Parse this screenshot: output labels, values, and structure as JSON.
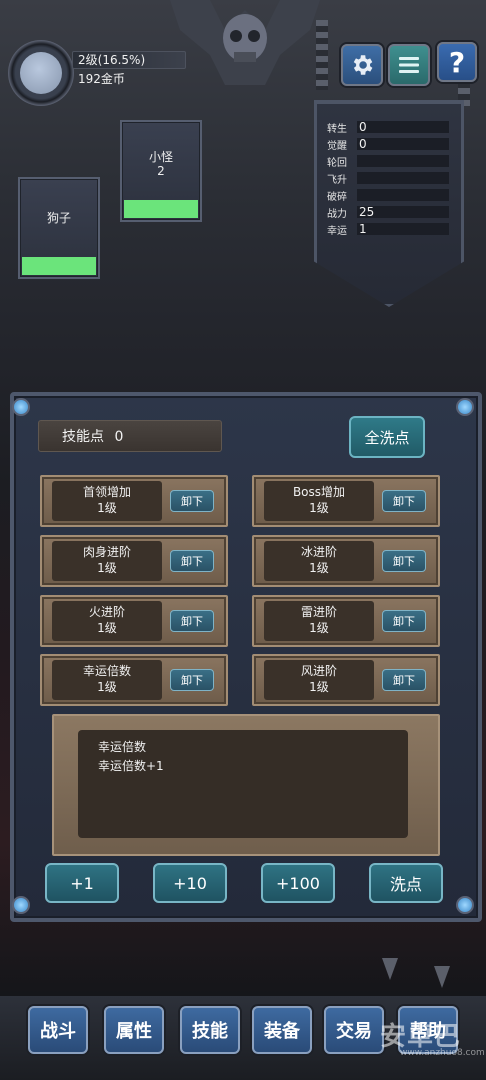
{
  "player": {
    "level_text": "2级(16.5%)",
    "gold_text": "192金币"
  },
  "top_buttons": {
    "settings_icon": "gear-icon",
    "menu_icon": "menu-icon",
    "help_label": "?"
  },
  "stats": [
    {
      "label": "转生",
      "value": "0"
    },
    {
      "label": "觉醒",
      "value": "0"
    },
    {
      "label": "轮回",
      "value": ""
    },
    {
      "label": "飞升",
      "value": ""
    },
    {
      "label": "破碎",
      "value": ""
    },
    {
      "label": "战力",
      "value": "25"
    },
    {
      "label": "幸运",
      "value": "1"
    }
  ],
  "monsters": [
    {
      "name": "小怪",
      "count": "2"
    },
    {
      "name": "狗子",
      "count": ""
    }
  ],
  "skills_panel": {
    "skill_points_label": "技能点",
    "skill_points_value": "0",
    "wash_all_label": "全洗点",
    "unload_label": "卸下",
    "skills": [
      {
        "name": "首领增加",
        "level": "1级"
      },
      {
        "name": "Boss增加",
        "level": "1级"
      },
      {
        "name": "肉身进阶",
        "level": "1级"
      },
      {
        "name": "冰进阶",
        "level": "1级"
      },
      {
        "name": "火进阶",
        "level": "1级"
      },
      {
        "name": "雷进阶",
        "level": "1级"
      },
      {
        "name": "幸运倍数",
        "level": "1级"
      },
      {
        "name": "风进阶",
        "level": "1级"
      }
    ],
    "description": {
      "title": "幸运倍数",
      "effect": "幸运倍数+1"
    },
    "buttons": {
      "plus1": "+1",
      "plus10": "+10",
      "plus100": "+100",
      "wash": "洗点"
    }
  },
  "nav": {
    "battle": "战斗",
    "attributes": "属性",
    "skills": "技能",
    "equipment": "装备",
    "trade": "交易",
    "more": "帮助"
  },
  "watermark": {
    "main": "安卓巴",
    "sub": "www.anzhuo8.com"
  },
  "colors": {
    "hp_bar": "#6be47b",
    "button_blue": "#3e6aa0",
    "button_teal": "#2f7383"
  }
}
